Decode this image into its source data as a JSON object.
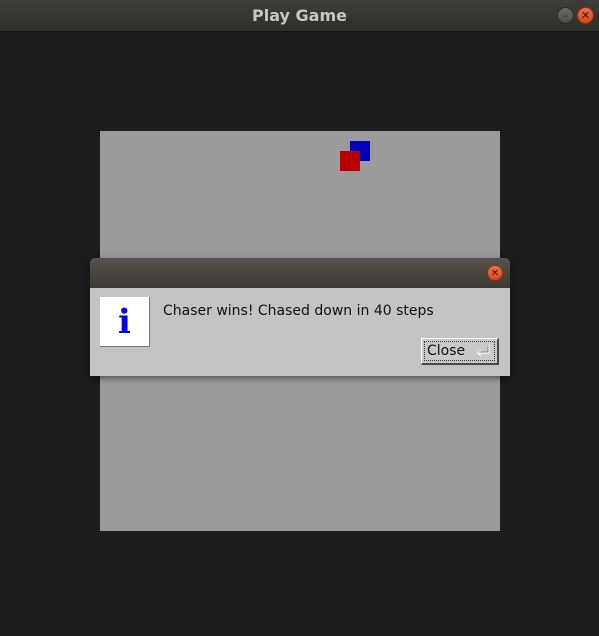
{
  "window": {
    "title": "Play Game",
    "minimize_glyph": "–",
    "close_glyph": "✕"
  },
  "game": {
    "pieces": [
      {
        "name": "blue-square",
        "color": "#0000b8"
      },
      {
        "name": "red-square",
        "color": "#b80000"
      }
    ]
  },
  "dialog": {
    "close_glyph": "✕",
    "icon": "info-icon",
    "icon_glyph": "i",
    "icon_color": "#0000e0",
    "message": "Chaser wins! Chased down in 40 steps",
    "button_label": "Close"
  }
}
